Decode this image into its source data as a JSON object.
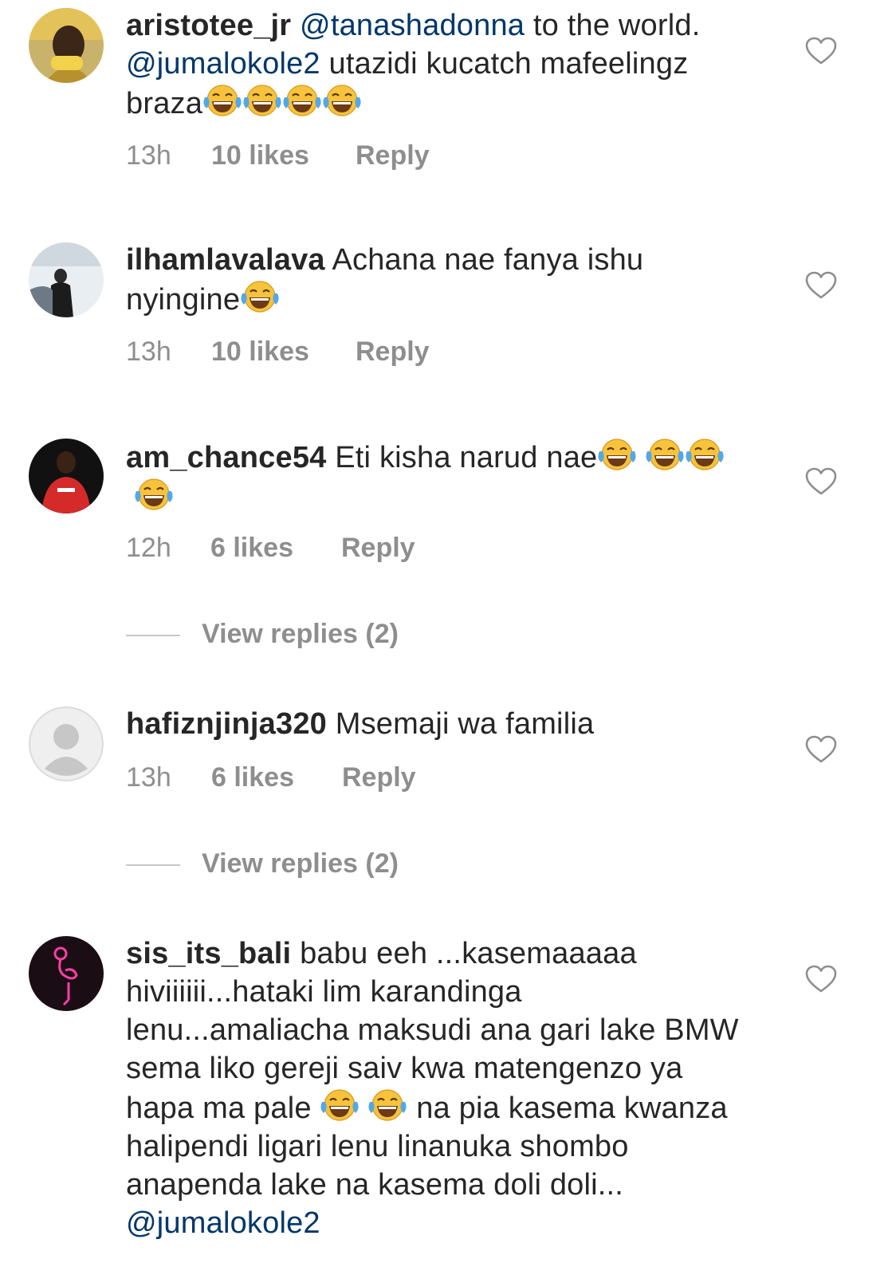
{
  "comments": [
    {
      "username": "aristotee_jr",
      "mention1": "@tanashadonna",
      "text1": " to the world. ",
      "mention2": "@jumalokole2",
      "text2": " utazidi kucatch mafeelingz braza",
      "time": "13h",
      "likes": "10 likes",
      "reply": "Reply"
    },
    {
      "username": "ilhamlavalava",
      "text": " Achana nae fanya ishu nyingine",
      "time": "13h",
      "likes": "10 likes",
      "reply": "Reply"
    },
    {
      "username": "am_chance54",
      "text": " Eti kisha narud nae",
      "time": "12h",
      "likes": "6 likes",
      "reply": "Reply",
      "view_replies": "View replies (2)"
    },
    {
      "username": "hafiznjinja320",
      "text": " Msemaji wa familia",
      "time": "13h",
      "likes": "6 likes",
      "reply": "Reply",
      "view_replies": "View replies (2)"
    },
    {
      "username": "sis_its_bali",
      "text1": " babu eeh ...kasemaaaaa hiviiiiii...hataki lim karandinga lenu...amaliacha maksudi ana gari lake BMW sema liko gereji saiv kwa matengenzo ya hapa ma pale ",
      "text2": " na pia kasema kwanza halipendi ligari lenu linanuka shombo anapenda lake na kasema doli doli... ",
      "mention": "@jumalokole2"
    }
  ],
  "icons": {
    "heart": "heart-outline-icon",
    "emoji": "face-with-tears-of-joy-icon",
    "default_avatar": "default-avatar-icon"
  },
  "colors": {
    "mention": "#00376b",
    "meta": "#8e8e8e",
    "text": "#262626"
  }
}
